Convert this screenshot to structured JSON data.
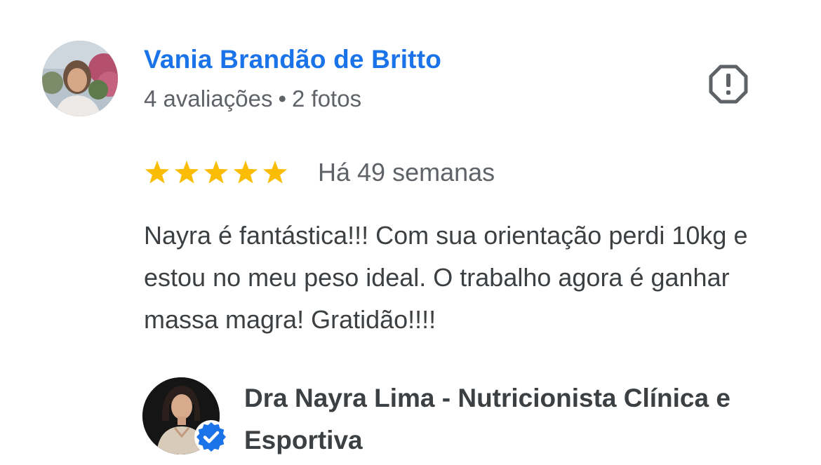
{
  "review": {
    "reviewer": {
      "name": "Vania Brandão de Britto",
      "reviews_count": "4 avaliações",
      "separator": "•",
      "photos_count": "2 fotos"
    },
    "rating": 5,
    "rating_max": 5,
    "date": "Há 49 semanas",
    "text": "Nayra é fantástica!!! Com sua orientação perdi 10kg e estou no meu peso ideal. O trabalho agora é ganhar massa magra! Gratidão!!!!"
  },
  "owner": {
    "name": "Dra Nayra Lima - Nutricionista Clínica e Esportiva",
    "verified": true
  },
  "icons": {
    "report": "report-octagon-icon",
    "star": "star-icon",
    "verified": "verified-badge-icon"
  },
  "colors": {
    "link": "#1a73e8",
    "star": "#fbbc04",
    "meta": "#5f6368",
    "text": "#3c4043",
    "verified": "#1a73e8"
  }
}
